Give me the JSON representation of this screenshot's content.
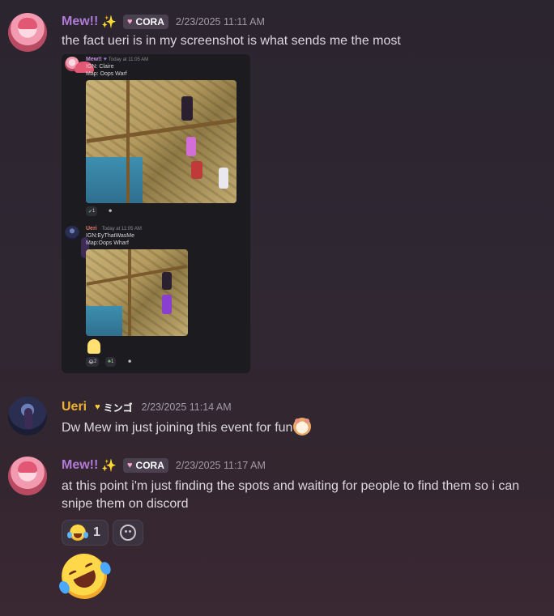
{
  "messages": [
    {
      "author": "Mew!!",
      "sparkle": "✨",
      "tag": "CORA",
      "timestamp": "2/23/2025 11:11 AM",
      "text": "the fact ueri is in my screenshot is what sends me the most",
      "attachment": {
        "posts": [
          {
            "author": "Mew!!",
            "timestamp": "Today at 11:05 AM",
            "lines": [
              "IGN: Claire",
              "Map: Oops Warf"
            ],
            "reactions": [
              {
                "emoji": "check",
                "count": "1"
              }
            ]
          },
          {
            "author": "Ueri",
            "timestamp": "Today at 11:05 AM",
            "lines": [
              "IGN:EyThatWasMe",
              "Map:Oops Wharf"
            ],
            "reactions": [
              {
                "emoji": "laugh",
                "count": "2"
              },
              {
                "emoji": "plant",
                "count": "1"
              }
            ]
          }
        ]
      }
    },
    {
      "author": "Ueri",
      "tag": "ミンゴ",
      "timestamp": "2/23/2025 11:14 AM",
      "text": "Dw Mew im just joining this event for fun",
      "emoji_icon": "hamster-icon"
    },
    {
      "author": "Mew!!",
      "sparkle": "✨",
      "tag": "CORA",
      "timestamp": "2/23/2025 11:17 AM",
      "text": "at this point i'm just finding the spots and waiting for people to find them so i can snipe them on discord",
      "reactions": [
        {
          "emoji": "joy-icon",
          "count": "1"
        }
      ],
      "big_emoji": "rofl-icon"
    }
  ],
  "colors": {
    "mew_name": "#b07ad6",
    "ueri_name": "#f0b132",
    "timestamp": "#a39aa6"
  }
}
